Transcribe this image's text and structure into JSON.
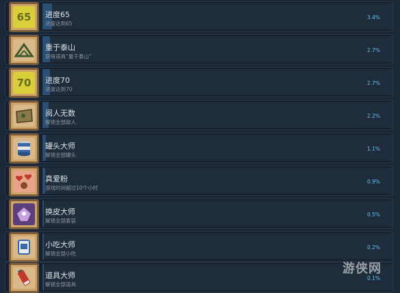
{
  "achievements": [
    {
      "title": "进度65",
      "desc": "进度达到65",
      "percent": "3.4%",
      "percent_value": 3.4,
      "icon": "number-65-icon",
      "icon_text": "65",
      "icon_bg": "#d8cf3a",
      "icon_fg": "#6b6a1c"
    },
    {
      "title": "重于泰山",
      "desc": "获得道具“重于泰山”",
      "percent": "2.7%",
      "percent_value": 2.7,
      "icon": "mountain-icon",
      "icon_text": "",
      "icon_bg": "#d9b98a",
      "icon_fg": "#3f5a2f"
    },
    {
      "title": "进度70",
      "desc": "进度达到70",
      "percent": "2.7%",
      "percent_value": 2.7,
      "icon": "number-70-icon",
      "icon_text": "70",
      "icon_bg": "#d8cf3a",
      "icon_fg": "#6b6a1c"
    },
    {
      "title": "阅人无数",
      "desc": "解锁全部敌人",
      "percent": "2.2%",
      "percent_value": 2.2,
      "icon": "map-icon",
      "icon_text": "",
      "icon_bg": "#d9b98a",
      "icon_fg": "#6a5a2e"
    },
    {
      "title": "罐头大师",
      "desc": "解锁全部罐头",
      "percent": "1.1%",
      "percent_value": 1.1,
      "icon": "can-icon",
      "icon_text": "",
      "icon_bg": "#d9b98a",
      "icon_fg": "#3a67a8"
    },
    {
      "title": "真爱粉",
      "desc": "游戏时间超过10个小时",
      "percent": "0.9%",
      "percent_value": 0.9,
      "icon": "hearts-icon",
      "icon_text": "",
      "icon_bg": "#e8a48a",
      "icon_fg": "#c0392b"
    },
    {
      "title": "换皮大师",
      "desc": "解锁全部套装",
      "percent": "0.5%",
      "percent_value": 0.5,
      "icon": "costume-icon",
      "icon_text": "",
      "icon_bg": "#5b3f7a",
      "icon_fg": "#c8a0e0"
    },
    {
      "title": "小吃大师",
      "desc": "解锁全部小吃",
      "percent": "0.2%",
      "percent_value": 0.2,
      "icon": "snack-icon",
      "icon_text": "",
      "icon_bg": "#d9b98a",
      "icon_fg": "#3a67a8"
    },
    {
      "title": "道具大师",
      "desc": "解锁全部道具",
      "percent": "0.1%",
      "percent_value": 0.1,
      "icon": "battery-icon",
      "icon_text": "",
      "icon_bg": "#d9b98a",
      "icon_fg": "#c0392b"
    }
  ],
  "watermark": "游侠网"
}
